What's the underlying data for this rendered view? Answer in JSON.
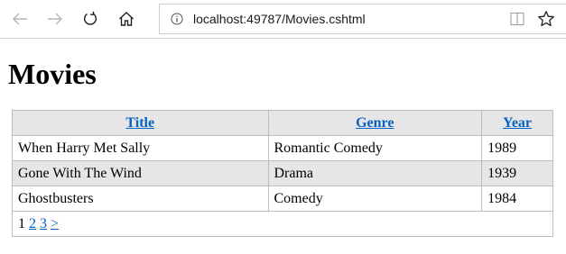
{
  "browser": {
    "url_host": "localhost",
    "url_path": ":49787/Movies.cshtml",
    "icons": {
      "back": "back-arrow-icon",
      "forward": "forward-arrow-icon",
      "refresh": "refresh-icon",
      "home": "home-icon",
      "info": "info-icon",
      "reading_view": "reading-view-icon",
      "favorite": "star-icon"
    }
  },
  "page": {
    "title": "Movies"
  },
  "table": {
    "headers": {
      "title": "Title",
      "genre": "Genre",
      "year": "Year"
    },
    "rows": [
      {
        "title": "When Harry Met Sally",
        "genre": "Romantic Comedy",
        "year": "1989"
      },
      {
        "title": "Gone With The Wind",
        "genre": "Drama",
        "year": "1939"
      },
      {
        "title": "Ghostbusters",
        "genre": "Comedy",
        "year": "1984"
      }
    ],
    "pager": {
      "current": "1",
      "page2": "2",
      "page3": "3",
      "next": ">"
    }
  },
  "colors": {
    "link": "#0563c1",
    "header_bg": "#e6e6e6",
    "alt_row_bg": "#e6e6e6",
    "border": "#bcbcbc"
  }
}
